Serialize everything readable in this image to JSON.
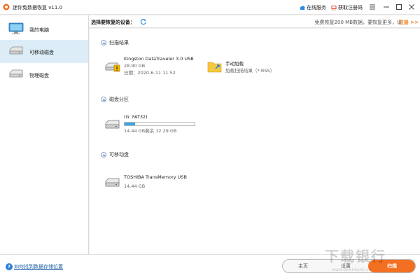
{
  "titlebar": {
    "app_title": "迷你兔数据恢复 v11.0",
    "service_label": "在线服务",
    "register_label": "获取注册码"
  },
  "sidebar": {
    "items": [
      {
        "label": "我的电脑",
        "icon": "monitor-icon"
      },
      {
        "label": "可移动磁盘",
        "icon": "removable-disk-icon",
        "selected": true
      },
      {
        "label": "物理磁盘",
        "icon": "physical-disk-icon"
      }
    ]
  },
  "device_bar": {
    "label": "选择要恢复的设备：",
    "promo_text": "免费恢复200 MB数据，要恢复更多，请",
    "promo_link": "注册 >>"
  },
  "sections": {
    "scan_results": {
      "title": "扫描结果",
      "device_name": "Kingston DataTraveler 3.0 USB",
      "device_size": "28.90 GB",
      "device_date": "日期：2020-6-11 11:52",
      "manual_title": "手动加载",
      "manual_sub": "加载扫描结果（*.RSS）"
    },
    "partitions": {
      "title": "磁盘分区",
      "name": "(G: FAT32)",
      "usage": "14.44 GB剩余 12.29 GB",
      "progress": 0.15
    },
    "removable": {
      "title": "可移动盘",
      "name": "TOSHIBA TransMemory USB",
      "size": "14.44 GB"
    }
  },
  "bottom": {
    "help_link": "如何找到数据存储位置",
    "home_label": "主页",
    "settings_label": "设置",
    "scan_label": "扫描"
  },
  "watermark": {
    "text": "下载银行",
    "url": "www.downbank.cn"
  },
  "colors": {
    "accent_orange": "#f36f21",
    "selected_bg": "#dcedf8",
    "progress_blue": "#3aa6e6",
    "link_blue": "#1d5fa8"
  }
}
